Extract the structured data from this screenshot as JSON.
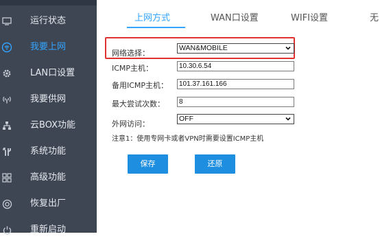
{
  "sidebar": {
    "items": [
      {
        "label": "运行状态",
        "icon": "monitor-icon",
        "active": false
      },
      {
        "label": "我要上网",
        "icon": "wifi-icon",
        "active": true
      },
      {
        "label": "LAN口设置",
        "icon": "gear-icon",
        "active": false
      },
      {
        "label": "我要供网",
        "icon": "broadcast-icon",
        "active": false
      },
      {
        "label": "云BOX功能",
        "icon": "network-icon",
        "active": false
      },
      {
        "label": "系统功能",
        "icon": "tools-icon",
        "active": false
      },
      {
        "label": "高级功能",
        "icon": "grid-icon",
        "active": false
      },
      {
        "label": "恢复出厂",
        "icon": "reset-icon",
        "active": false
      },
      {
        "label": "重新启动",
        "icon": "power-icon",
        "active": false
      }
    ],
    "active_color": "#33a4ff"
  },
  "tabs": [
    {
      "label": "上网方式",
      "active": true
    },
    {
      "label": "WAN口设置",
      "active": false
    },
    {
      "label": "WIFI设置",
      "active": false
    },
    {
      "label": "无",
      "active": false
    }
  ],
  "form": {
    "network_select": {
      "label": "网络选择：",
      "value": "WAN&MOBILE"
    },
    "icmp_host": {
      "label": "ICMP主机：",
      "value": "10.30.6.54"
    },
    "backup_icmp_host": {
      "label": "备用ICMP主机：",
      "value": "101.37.161.166"
    },
    "max_retries": {
      "label": "最大尝试次数：",
      "value": "8"
    },
    "external_access": {
      "label": "外网访问：",
      "value": "OFF"
    },
    "note": "注意1：使用专网卡或者VPN时需要设置ICMP主机"
  },
  "buttons": {
    "save": "保存",
    "restore": "还原"
  },
  "colors": {
    "sidebar_bg": "#3e4654",
    "accent": "#33a4ff",
    "button": "#1e8fe0",
    "highlight": "#e03131"
  }
}
